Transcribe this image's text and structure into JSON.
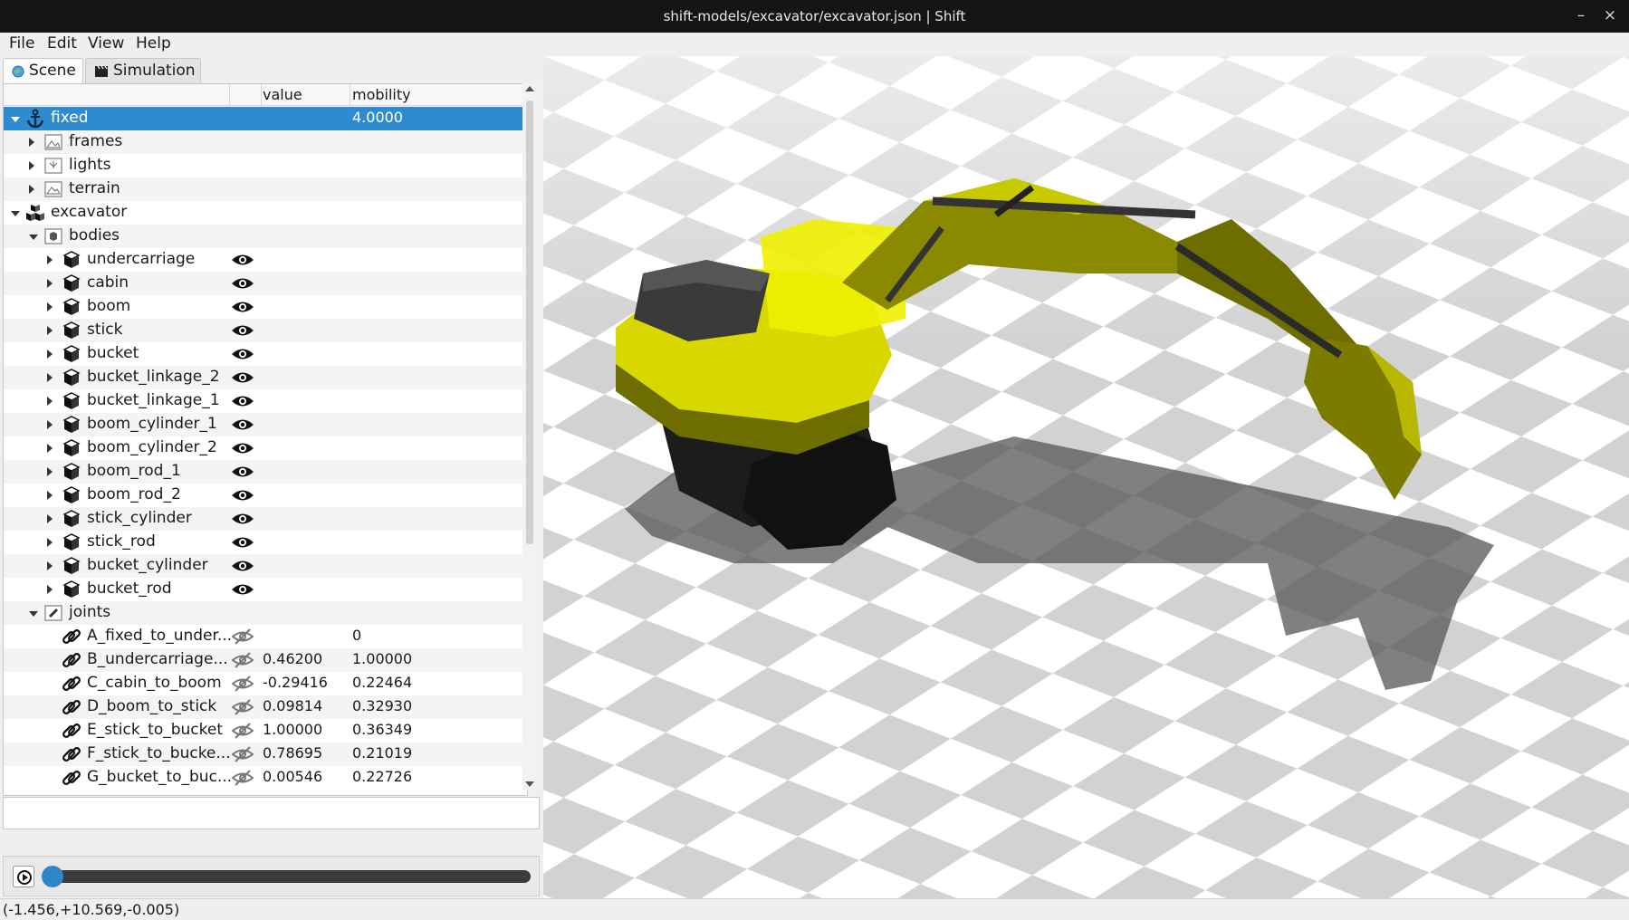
{
  "window": {
    "title": "shift-models/excavator/excavator.json | Shift",
    "minimize": "–",
    "close": "×"
  },
  "menu": [
    "File",
    "Edit",
    "View",
    "Help"
  ],
  "tabs": [
    {
      "label": "Scene",
      "icon": "globe-icon",
      "active": true
    },
    {
      "label": "Simulation",
      "icon": "clapperboard-icon",
      "active": false
    }
  ],
  "tree": {
    "columns": [
      "",
      "",
      "value",
      "mobility"
    ],
    "rows": [
      {
        "label": "fixed",
        "icon": "anchor-icon",
        "expand": "down",
        "indent": 0,
        "value": "",
        "mobility": "4.0000",
        "eye": "none",
        "selected": true
      },
      {
        "label": "frames",
        "icon": "frames-icon",
        "expand": "right",
        "indent": 1,
        "value": "",
        "mobility": "",
        "eye": "none"
      },
      {
        "label": "lights",
        "icon": "lights-icon",
        "expand": "right",
        "indent": 1,
        "value": "",
        "mobility": "",
        "eye": "none"
      },
      {
        "label": "terrain",
        "icon": "terrain-icon",
        "expand": "right",
        "indent": 1,
        "value": "",
        "mobility": "",
        "eye": "none"
      },
      {
        "label": "excavator",
        "icon": "model-icon",
        "expand": "down",
        "indent": 0,
        "value": "",
        "mobility": "",
        "eye": "none"
      },
      {
        "label": "bodies",
        "icon": "bodies-folder-icon",
        "expand": "down",
        "indent": 1,
        "value": "",
        "mobility": "",
        "eye": "none"
      },
      {
        "label": "undercarriage",
        "icon": "body-cube-icon",
        "expand": "right",
        "indent": 2,
        "value": "",
        "mobility": "",
        "eye": "open"
      },
      {
        "label": "cabin",
        "icon": "body-cube-icon",
        "expand": "right",
        "indent": 2,
        "value": "",
        "mobility": "",
        "eye": "open"
      },
      {
        "label": "boom",
        "icon": "body-cube-icon",
        "expand": "right",
        "indent": 2,
        "value": "",
        "mobility": "",
        "eye": "open"
      },
      {
        "label": "stick",
        "icon": "body-cube-icon",
        "expand": "right",
        "indent": 2,
        "value": "",
        "mobility": "",
        "eye": "open"
      },
      {
        "label": "bucket",
        "icon": "body-cube-icon",
        "expand": "right",
        "indent": 2,
        "value": "",
        "mobility": "",
        "eye": "open"
      },
      {
        "label": "bucket_linkage_2",
        "icon": "body-cube-icon",
        "expand": "right",
        "indent": 2,
        "value": "",
        "mobility": "",
        "eye": "open"
      },
      {
        "label": "bucket_linkage_1",
        "icon": "body-cube-icon",
        "expand": "right",
        "indent": 2,
        "value": "",
        "mobility": "",
        "eye": "open"
      },
      {
        "label": "boom_cylinder_1",
        "icon": "body-cube-icon",
        "expand": "right",
        "indent": 2,
        "value": "",
        "mobility": "",
        "eye": "open"
      },
      {
        "label": "boom_cylinder_2",
        "icon": "body-cube-icon",
        "expand": "right",
        "indent": 2,
        "value": "",
        "mobility": "",
        "eye": "open"
      },
      {
        "label": "boom_rod_1",
        "icon": "body-cube-icon",
        "expand": "right",
        "indent": 2,
        "value": "",
        "mobility": "",
        "eye": "open"
      },
      {
        "label": "boom_rod_2",
        "icon": "body-cube-icon",
        "expand": "right",
        "indent": 2,
        "value": "",
        "mobility": "",
        "eye": "open"
      },
      {
        "label": "stick_cylinder",
        "icon": "body-cube-icon",
        "expand": "right",
        "indent": 2,
        "value": "",
        "mobility": "",
        "eye": "open"
      },
      {
        "label": "stick_rod",
        "icon": "body-cube-icon",
        "expand": "right",
        "indent": 2,
        "value": "",
        "mobility": "",
        "eye": "open"
      },
      {
        "label": "bucket_cylinder",
        "icon": "body-cube-icon",
        "expand": "right",
        "indent": 2,
        "value": "",
        "mobility": "",
        "eye": "open"
      },
      {
        "label": "bucket_rod",
        "icon": "body-cube-icon",
        "expand": "right",
        "indent": 2,
        "value": "",
        "mobility": "",
        "eye": "open"
      },
      {
        "label": "joints",
        "icon": "joints-folder-icon",
        "expand": "down",
        "indent": 1,
        "value": "",
        "mobility": "",
        "eye": "none"
      },
      {
        "label": "A_fixed_to_under...",
        "icon": "joint-link-icon",
        "expand": "none",
        "indent": 2,
        "value": "",
        "mobility": "0",
        "eye": "hidden"
      },
      {
        "label": "B_undercarriage...",
        "icon": "joint-link-icon",
        "expand": "none",
        "indent": 2,
        "value": "0.46200",
        "mobility": "1.00000",
        "eye": "hidden"
      },
      {
        "label": "C_cabin_to_boom",
        "icon": "joint-link-icon",
        "expand": "none",
        "indent": 2,
        "value": "-0.29416",
        "mobility": "0.22464",
        "eye": "hidden"
      },
      {
        "label": "D_boom_to_stick",
        "icon": "joint-link-icon",
        "expand": "none",
        "indent": 2,
        "value": "0.09814",
        "mobility": "0.32930",
        "eye": "hidden"
      },
      {
        "label": "E_stick_to_bucket",
        "icon": "joint-link-icon",
        "expand": "none",
        "indent": 2,
        "value": "1.00000",
        "mobility": "0.36349",
        "eye": "hidden"
      },
      {
        "label": "F_stick_to_bucke...",
        "icon": "joint-link-icon",
        "expand": "none",
        "indent": 2,
        "value": "0.78695",
        "mobility": "0.21019",
        "eye": "hidden"
      },
      {
        "label": "G_bucket_to_buc...",
        "icon": "joint-link-icon",
        "expand": "none",
        "indent": 2,
        "value": "0.00546",
        "mobility": "0.22726",
        "eye": "hidden"
      }
    ]
  },
  "playback": {
    "play_icon": "play-icon",
    "progress": 0.0
  },
  "status": "(-1.456,+10.569,-0.005)",
  "colors": {
    "selection": "#2f8bd0",
    "machine_yellow": "#e6e600",
    "slider_knob": "#2e86c9"
  }
}
